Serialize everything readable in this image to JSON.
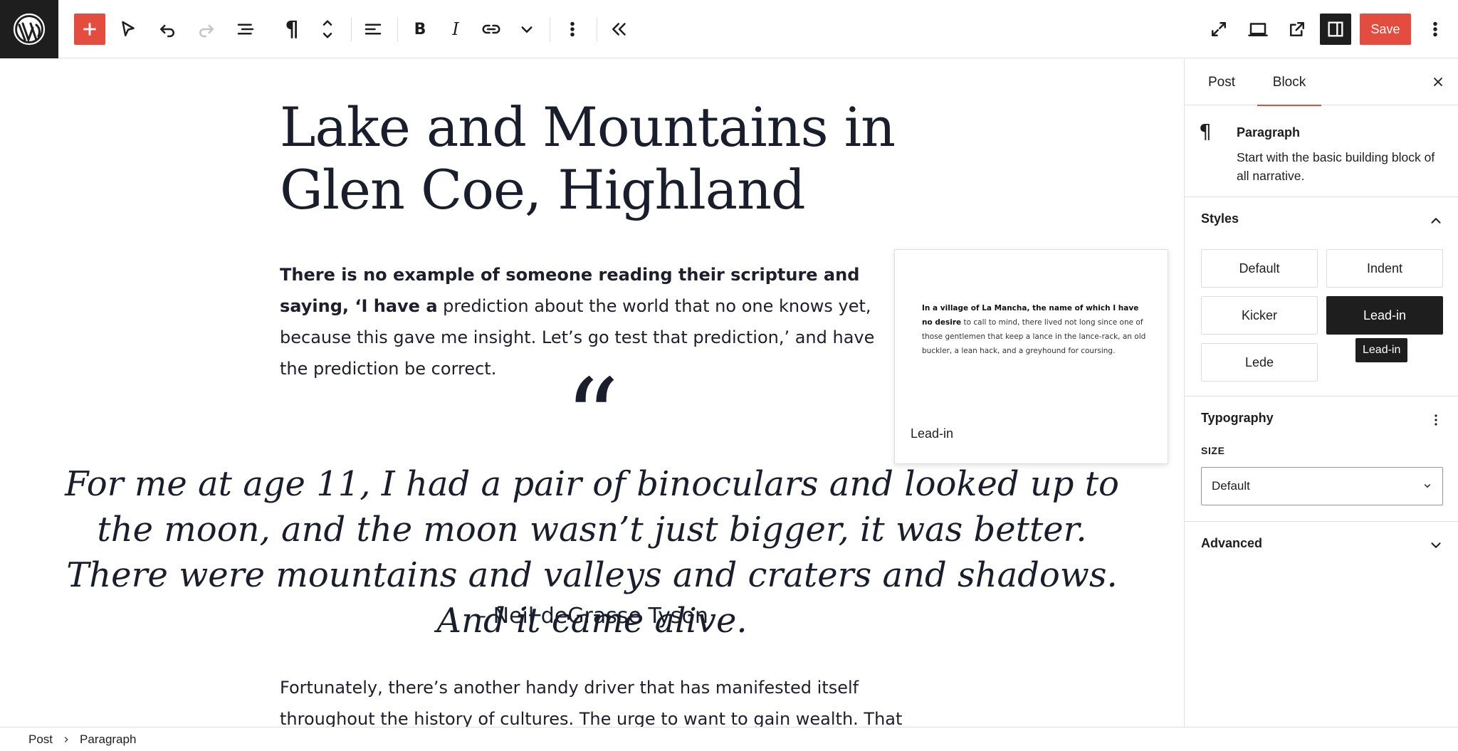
{
  "toolbar": {
    "save_label": "Save",
    "icons": [
      "wordpress-logo",
      "plus-icon",
      "select-tool-icon",
      "undo-icon",
      "redo-icon",
      "list-view-icon",
      "paragraph-icon",
      "move-up-down-icon",
      "align-icon",
      "bold-icon",
      "italic-icon",
      "link-icon",
      "more-formats-icon",
      "options-icon",
      "collapse-icon",
      "fullscreen-icon",
      "preview-icon",
      "external-link-icon",
      "settings-icon",
      "kebab-icon"
    ]
  },
  "post": {
    "title": "Lake and Mountains in Glen Coe, Highland",
    "leadin_bold": "There is no example of someone reading their scripture and saying, ‘I have a",
    "leadin_rest": "prediction about the world that no one knows yet, because this gave me insight. Let’s go test that prediction,’ and have the prediction be correct.",
    "quote_mark": "“",
    "quote": "For me at age 11, I had a pair of binoculars and looked up to the moon, and the moon wasn’t just bigger, it was better. There were mountains and valleys and craters and shadows. And it came alive.",
    "citation": "– Neil deGrasse Tyson",
    "after": "Fortunately, there’s another handy driver that has manifested itself throughout the history of cultures. The urge to want to gain wealth. That is almost as potent"
  },
  "preview": {
    "bold": "In a village of La Mancha, the name of which I have no desire",
    "text": "to call to mind, there lived not long since one of those gentlemen that keep a lance in the lance-rack, an old buckler, a lean hack, and a greyhound for coursing.",
    "label": "Lead-in"
  },
  "sidebar": {
    "tabs": [
      {
        "label": "Post"
      },
      {
        "label": "Block"
      }
    ],
    "active_tab": "Block",
    "block": {
      "name": "Paragraph",
      "description": "Start with the basic building block of all narrative."
    },
    "styles": {
      "title": "Styles",
      "options": [
        "Default",
        "Indent",
        "Kicker",
        "Lead-in",
        "Lede"
      ],
      "active": "Lead-in",
      "tooltip": "Lead-in"
    },
    "typography": {
      "title": "Typography",
      "size_label": "SIZE",
      "size_value": "Default"
    },
    "advanced": {
      "title": "Advanced"
    }
  },
  "breadcrumb": [
    "Post",
    "Paragraph"
  ],
  "colors": {
    "accent": "#e34c3f",
    "dark": "#1e1e1e"
  }
}
